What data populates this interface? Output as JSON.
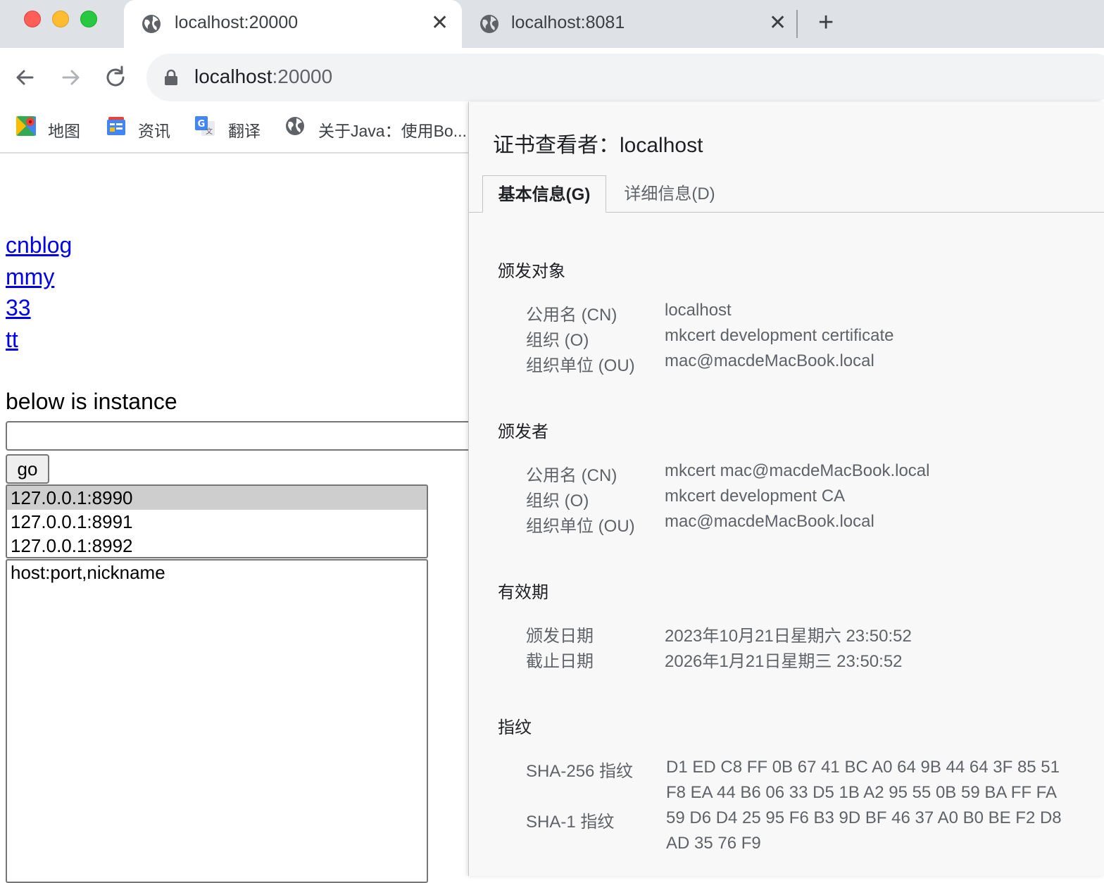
{
  "colors": {
    "close": "#ff5f57",
    "minimize": "#febc2e",
    "maximize": "#28c840",
    "link": "#0000ee"
  },
  "tabs": [
    {
      "title": "localhost:20000",
      "icon": "globe-icon",
      "active": true
    },
    {
      "title": "localhost:8081",
      "icon": "globe-icon",
      "active": false
    }
  ],
  "toolbar": {
    "url_host": "localhost",
    "url_port": ":20000"
  },
  "bookmarks": [
    {
      "label": "地图",
      "icon": "maps-icon"
    },
    {
      "label": "资讯",
      "icon": "news-icon"
    },
    {
      "label": "翻译",
      "icon": "translate-icon"
    },
    {
      "label": "关于Java：使用Bo...",
      "icon": "globe-icon"
    }
  ],
  "page": {
    "links": [
      "cnblog",
      "mmy",
      "33",
      "tt"
    ],
    "below_text": "below is instance",
    "input_value": "",
    "go_label": "go",
    "options": [
      "127.0.0.1:8990",
      "127.0.0.1:8991",
      "127.0.0.1:8992"
    ],
    "textarea_value": "host:port,nickname"
  },
  "cert": {
    "title": "证书查看者：localhost",
    "tab_basic": "基本信息(G)",
    "tab_detail": "详细信息(D)",
    "subject_head": "颁发对象",
    "subject": [
      {
        "key": "公用名 (CN)",
        "value": "localhost"
      },
      {
        "key": "组织 (O)",
        "value": "mkcert development certificate"
      },
      {
        "key": "组织单位 (OU)",
        "value": "mac@macdeMacBook.local"
      }
    ],
    "issuer_head": "颁发者",
    "issuer": [
      {
        "key": "公用名 (CN)",
        "value": "mkcert mac@macdeMacBook.local"
      },
      {
        "key": "组织 (O)",
        "value": "mkcert development CA"
      },
      {
        "key": "组织单位 (OU)",
        "value": "mac@macdeMacBook.local"
      }
    ],
    "validity_head": "有效期",
    "validity": [
      {
        "key": "颁发日期",
        "value": "2023年10月21日星期六 23:50:52"
      },
      {
        "key": "截止日期",
        "value": "2026年1月21日星期三 23:50:52"
      }
    ],
    "fingerprint_head": "指纹",
    "sha256_key": "SHA-256 指纹",
    "sha256_line1": "D1 ED C8 FF 0B 67 41 BC A0 64 9B 44 64 3F 85 51",
    "sha256_line2": "F8 EA 44 B6 06 33 D5 1B A2 95 55 0B 59 BA FF FA",
    "sha1_key": "SHA-1 指纹",
    "sha1_line1": "59 D6 D4 25 95 F6 B3 9D BF 46 37 A0 B0 BE F2 D8",
    "sha1_line2": "AD 35 76 F9"
  }
}
